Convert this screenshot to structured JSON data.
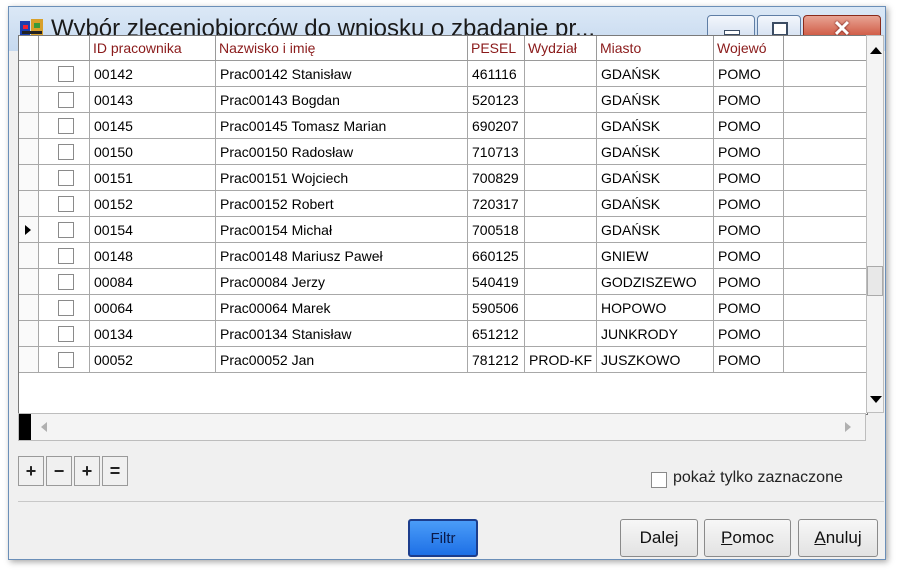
{
  "window": {
    "title": "Wybór zleceniobiorców do wniosku o zbadanie pr..."
  },
  "grid": {
    "columns": [
      "ID pracownika",
      "Nazwisko i imię",
      "PESEL",
      "Wydział",
      "Miasto",
      "Wojewó"
    ],
    "rows": [
      {
        "id": "00142",
        "name": "Prac00142 Stanisław",
        "pesel": "461116",
        "dept": "",
        "city": "GDAŃSK",
        "voiv": "POMO"
      },
      {
        "id": "00143",
        "name": "Prac00143 Bogdan",
        "pesel": "520123",
        "dept": "",
        "city": "GDAŃSK",
        "voiv": "POMO"
      },
      {
        "id": "00145",
        "name": "Prac00145 Tomasz Marian",
        "pesel": "690207",
        "dept": "",
        "city": "GDAŃSK",
        "voiv": "POMO"
      },
      {
        "id": "00150",
        "name": "Prac00150 Radosław",
        "pesel": "710713",
        "dept": "",
        "city": "GDAŃSK",
        "voiv": "POMO"
      },
      {
        "id": "00151",
        "name": "Prac00151 Wojciech",
        "pesel": "700829",
        "dept": "",
        "city": "GDAŃSK",
        "voiv": "POMO"
      },
      {
        "id": "00152",
        "name": "Prac00152 Robert",
        "pesel": "720317",
        "dept": "",
        "city": "GDAŃSK",
        "voiv": "POMO"
      },
      {
        "id": "00154",
        "name": "Prac00154 Michał",
        "pesel": "700518",
        "dept": "",
        "city": "GDAŃSK",
        "voiv": "POMO"
      },
      {
        "id": "00148",
        "name": "Prac00148 Mariusz Paweł",
        "pesel": "660125",
        "dept": "",
        "city": "GNIEW",
        "voiv": "POMO"
      },
      {
        "id": "00084",
        "name": "Prac00084 Jerzy",
        "pesel": "540419",
        "dept": "",
        "city": "GODZISZEWO",
        "voiv": "POMO"
      },
      {
        "id": "00064",
        "name": "Prac00064 Marek",
        "pesel": "590506",
        "dept": "",
        "city": "HOPOWO",
        "voiv": "POMO"
      },
      {
        "id": "00134",
        "name": "Prac00134 Stanisław",
        "pesel": "651212",
        "dept": "",
        "city": "JUNKRODY",
        "voiv": "POMO"
      },
      {
        "id": "00052",
        "name": "Prac00052 Jan",
        "pesel": "781212",
        "dept": "PROD-KF",
        "city": "JUSZKOWO",
        "voiv": "POMO"
      }
    ],
    "selected_row": 6
  },
  "toolbar": {
    "add": "+",
    "remove": "−",
    "add_all": "+",
    "remove_all": "="
  },
  "filter": {
    "show_only_selected": "pokaż tylko zaznaczone"
  },
  "buttons": {
    "filtr": "Filtr",
    "dalej": "Dalej",
    "pomoc_u": "P",
    "pomoc_rest": "omoc",
    "anuluj_u": "A",
    "anuluj_rest": "nuluj"
  }
}
